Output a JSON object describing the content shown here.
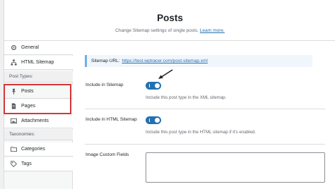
{
  "header": {
    "title": "Posts",
    "subtitle": "Change Sitemap settings of single posts.",
    "learn_more": "Learn more."
  },
  "sidebar": {
    "items_top": [
      {
        "label": "General",
        "icon": "gear-icon"
      },
      {
        "label": "HTML Sitemap",
        "icon": "sitemap-icon"
      }
    ],
    "post_types_label": "Post Types:",
    "post_types": [
      {
        "label": "Posts",
        "icon": "pin-icon"
      },
      {
        "label": "Pages",
        "icon": "page-icon"
      },
      {
        "label": "Attachments",
        "icon": "media-icon"
      }
    ],
    "taxonomies_label": "Taxonomies:",
    "taxonomies": [
      {
        "label": "Categories",
        "icon": "folder-icon"
      },
      {
        "label": "Tags",
        "icon": "tag-icon"
      }
    ]
  },
  "main": {
    "sitemap_url_label": "Sitemap URL:",
    "sitemap_url": "https://test.wptracer.com/post-sitemap.xml",
    "include_sitemap_label": "Include in Sitemap",
    "include_sitemap_desc": "Include this post type in the XML sitemap.",
    "include_sitemap_on": true,
    "include_html_label": "Include in HTML Sitemap",
    "include_html_desc": "Include this post type in the HTML sitemap if it's enabled.",
    "include_html_on": true,
    "custom_fields_label": "Image Custom Fields",
    "custom_fields_value": ""
  },
  "colors": {
    "accent": "#2271b1",
    "highlight": "#d63638"
  }
}
